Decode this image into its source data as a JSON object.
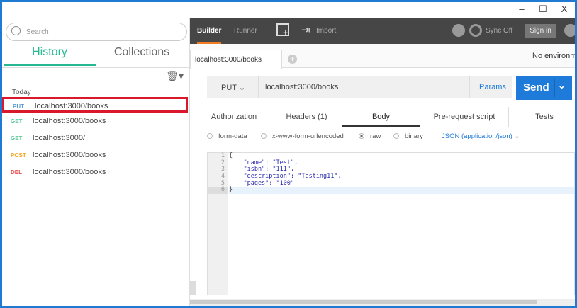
{
  "window": {
    "minimize": "–",
    "maximize": "☐",
    "close": "X"
  },
  "sidebar": {
    "search_placeholder": "Search",
    "tabs": [
      "History",
      "Collections"
    ],
    "group": "Today",
    "items": [
      {
        "method": "PUT",
        "url": "localhost:3000/books",
        "color": "#5b9bd5"
      },
      {
        "method": "GET",
        "url": "localhost:3000/books",
        "color": "#5cc89a"
      },
      {
        "method": "GET",
        "url": "localhost:3000/",
        "color": "#5cc89a"
      },
      {
        "method": "POST",
        "url": "localhost:3000/books",
        "color": "#f5a623"
      },
      {
        "method": "DEL",
        "url": "localhost:3000/books",
        "color": "#e64c4c"
      }
    ]
  },
  "topbar": {
    "builder": "Builder",
    "runner": "Runner",
    "import": "Import",
    "sync": "Sync Off",
    "signin": "Sign in"
  },
  "tab": {
    "label": "localhost:3000/books",
    "env": "No environment"
  },
  "request": {
    "method": "PUT",
    "url": "localhost:3000/books",
    "params": "Params",
    "send": "Send"
  },
  "body_tabs": [
    "Authorization",
    "Headers (1)",
    "Body",
    "Pre-request script",
    "Tests"
  ],
  "body_modes": [
    "form-data",
    "x-www-form-urlencoded",
    "raw",
    "binary"
  ],
  "content_type": "JSON (application/json)",
  "code": {
    "lines": [
      "1",
      "2",
      "3",
      "4",
      "5",
      "6"
    ],
    "text": [
      "{",
      "    \"name\": \"Test\",",
      "    \"isbn\": \"111\",",
      "    \"description\": \"Testing11\",",
      "    \"pages\": \"100\"",
      "}"
    ]
  }
}
